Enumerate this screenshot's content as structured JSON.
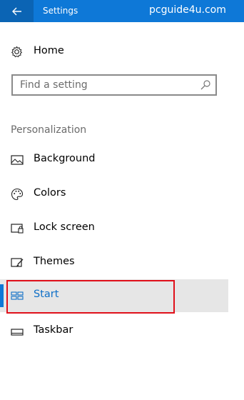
{
  "titlebar": {
    "title": "Settings",
    "watermark": "pcguide4u.com",
    "back_icon": "back-arrow-icon"
  },
  "home": {
    "label": "Home",
    "icon": "gear-icon"
  },
  "search": {
    "placeholder": "Find a setting",
    "value": "",
    "icon": "search-icon"
  },
  "section": {
    "header": "Personalization"
  },
  "nav": {
    "items": [
      {
        "label": "Background",
        "icon": "picture-icon"
      },
      {
        "label": "Colors",
        "icon": "palette-icon"
      },
      {
        "label": "Lock screen",
        "icon": "lock-screen-icon"
      },
      {
        "label": "Themes",
        "icon": "brush-icon"
      },
      {
        "label": "Start",
        "icon": "start-tiles-icon",
        "selected": true
      },
      {
        "label": "Taskbar",
        "icon": "taskbar-icon"
      }
    ]
  },
  "colors": {
    "accent": "#0e78d7",
    "titlebar": "#0e78d7",
    "selected_bg": "#e6e6e6",
    "annotation_border": "#e0101a"
  }
}
